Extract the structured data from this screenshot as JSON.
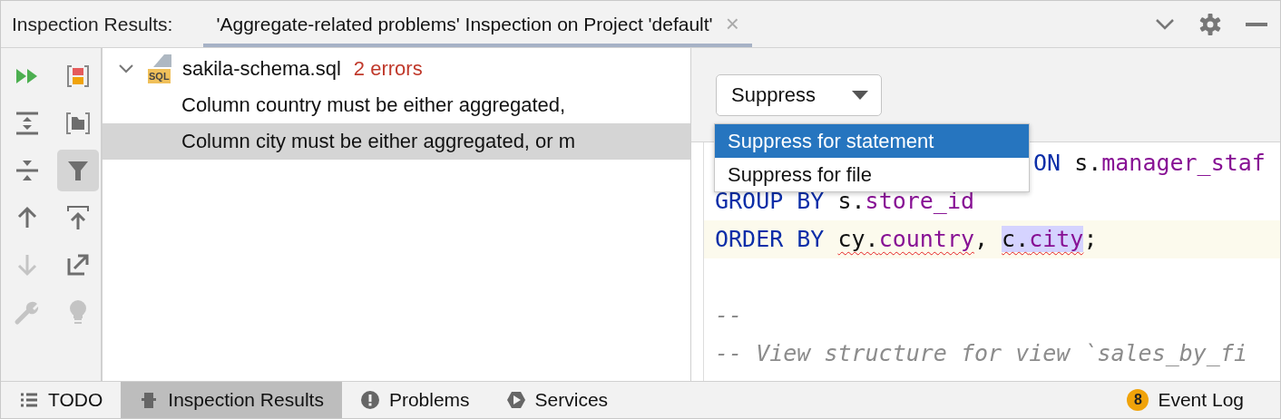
{
  "header": {
    "title": "Inspection Results:",
    "tab": {
      "label": "'Aggregate-related problems' Inspection on Project 'default'",
      "close": "×",
      "selected": true
    }
  },
  "toolbar": [
    {
      "kind": "rerun",
      "disabled": false,
      "selected": false
    },
    {
      "kind": "severity",
      "disabled": false,
      "selected": false
    },
    {
      "kind": "expand",
      "disabled": false,
      "selected": false
    },
    {
      "kind": "group-folder",
      "disabled": false,
      "selected": false
    },
    {
      "kind": "collapse",
      "disabled": false,
      "selected": false
    },
    {
      "kind": "filter",
      "disabled": false,
      "selected": true
    },
    {
      "kind": "up",
      "disabled": false,
      "selected": false
    },
    {
      "kind": "to-top",
      "disabled": false,
      "selected": false
    },
    {
      "kind": "down",
      "disabled": true,
      "selected": false
    },
    {
      "kind": "export",
      "disabled": false,
      "selected": false
    },
    {
      "kind": "wrench",
      "disabled": true,
      "selected": false
    },
    {
      "kind": "bulb",
      "disabled": true,
      "selected": false
    }
  ],
  "tree": {
    "file": "sakila-schema.sql",
    "file_badge": "SQL",
    "count": "2 errors",
    "expanded": true,
    "children": [
      {
        "label": "Column country must be either aggregated,",
        "selected": false
      },
      {
        "label": "Column city must be either aggregated, or m",
        "selected": true
      }
    ]
  },
  "suppress": {
    "label": "Suppress",
    "menu": [
      {
        "label": "Suppress for statement",
        "selected": true
      },
      {
        "label": "Suppress for file",
        "selected": false
      }
    ]
  },
  "code": [
    {
      "kind": "covered",
      "current": false,
      "tokens": [
        {
          "text": "ON ",
          "kind": "keyword"
        },
        {
          "text": "s.",
          "kind": "plain"
        },
        {
          "text": "manager_staf",
          "kind": "field"
        }
      ]
    },
    {
      "kind": "full",
      "current": false,
      "tokens": [
        {
          "text": "GROUP BY ",
          "kind": "keyword"
        },
        {
          "text": "s.",
          "kind": "plain"
        },
        {
          "text": "store_id",
          "kind": "field"
        }
      ]
    },
    {
      "kind": "full",
      "current": true,
      "tokens": [
        {
          "text": "ORDER BY ",
          "kind": "keyword"
        },
        {
          "text": "cy.",
          "kind": "plain",
          "error": true
        },
        {
          "text": "country",
          "kind": "field",
          "error": true
        },
        {
          "text": ", ",
          "kind": "plain"
        },
        {
          "text": "c.",
          "kind": "plain",
          "error": true,
          "highlighted": true
        },
        {
          "text": "city",
          "kind": "field",
          "error": true,
          "highlighted": true
        },
        {
          "text": ";",
          "kind": "plain"
        }
      ]
    },
    {
      "kind": "full",
      "current": false
    },
    {
      "kind": "full",
      "current": false,
      "tokens": [
        {
          "text": "--",
          "kind": "comment"
        }
      ]
    },
    {
      "kind": "full",
      "current": false,
      "tokens": [
        {
          "text": "-- View structure for view `sales_by_fi",
          "kind": "comment"
        }
      ]
    }
  ],
  "bottom_tabs": [
    {
      "label": "TODO",
      "kind": "todo",
      "selected": false
    },
    {
      "label": "Inspection Results",
      "kind": "inspect",
      "selected": true
    },
    {
      "label": "Problems",
      "kind": "problems",
      "selected": false
    },
    {
      "label": "Services",
      "kind": "services",
      "selected": false
    }
  ],
  "event_log": {
    "label": "Event Log",
    "count": "8"
  }
}
